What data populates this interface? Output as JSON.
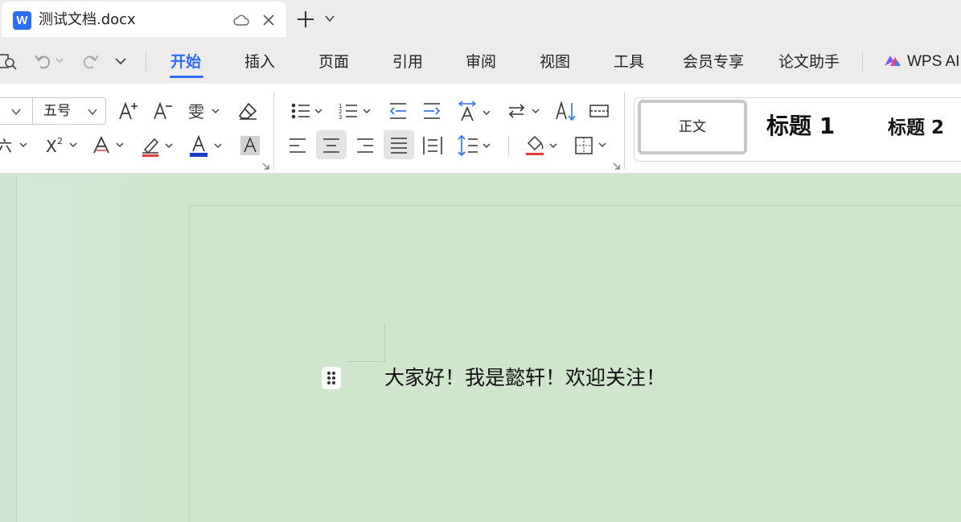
{
  "tab": {
    "title": "测试文档.docx"
  },
  "menu": {
    "items": [
      "开始",
      "插入",
      "页面",
      "引用",
      "审阅",
      "视图",
      "工具",
      "会员专享",
      "论文助手"
    ],
    "ai_label": "WPS AI"
  },
  "font": {
    "size": "五号"
  },
  "styles": {
    "normal": "正文",
    "heading1": "标题 1",
    "heading2": "标题 2"
  },
  "document": {
    "text": "大家好！我是懿轩！欢迎关注！"
  },
  "colors": {
    "accent": "#2b6ef4",
    "font_color": "#1a3cc8",
    "highlight": "#e23b3b",
    "page_bg": "#cfe6cc"
  },
  "icons": [
    "word-logo-icon",
    "cloud-icon",
    "close-icon",
    "plus-icon",
    "chevron-down-icon",
    "print-preview-icon",
    "undo-icon",
    "redo-icon",
    "customize-icon",
    "increase-font-icon",
    "decrease-font-icon",
    "phonetic-guide-icon",
    "clear-format-icon",
    "bullet-list-icon",
    "numbered-list-icon",
    "decrease-indent-icon",
    "increase-indent-icon",
    "text-direction-icon",
    "text-flow-icon",
    "sort-icon",
    "table-border-icon",
    "superscript-icon",
    "text-effect-icon",
    "highlight-icon",
    "font-color-icon",
    "char-shading-icon",
    "align-left-icon",
    "align-center-icon",
    "align-right-icon",
    "justify-icon",
    "distributed-icon",
    "line-spacing-icon",
    "shading-icon",
    "borders-icon",
    "drag-handle-icon"
  ]
}
